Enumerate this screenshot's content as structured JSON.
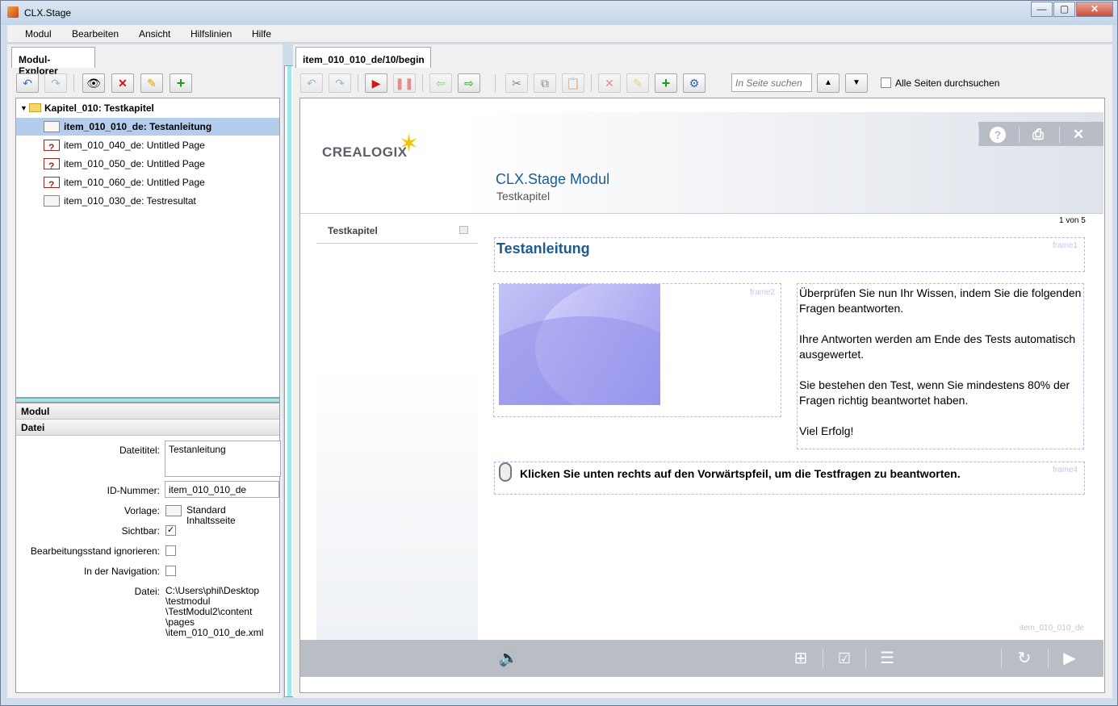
{
  "window": {
    "title": "CLX.Stage",
    "btn_minimize": "—",
    "btn_maximize": "▢",
    "btn_close": "✕"
  },
  "menu": [
    "Modul",
    "Bearbeiten",
    "Ansicht",
    "Hilfslinien",
    "Hilfe"
  ],
  "left_tab": "Modul-Explorer",
  "tree": {
    "folder": "Kapitel_010: Testkapitel",
    "items": [
      {
        "label": "item_010_010_de: Testanleitung",
        "selected": true
      },
      {
        "label": "item_010_040_de: Untitled Page"
      },
      {
        "label": "item_010_050_de: Untitled Page"
      },
      {
        "label": "item_010_060_de: Untitled Page"
      },
      {
        "label": "item_010_030_de: Testresultat"
      }
    ]
  },
  "props": {
    "section1": "Modul",
    "section2": "Datei",
    "dateititel_label": "Dateititel:",
    "dateititel": "Testanleitung",
    "id_label": "ID-Nummer:",
    "id": "item_010_010_de",
    "vorlage_label": "Vorlage:",
    "vorlage_line1": "Standard",
    "vorlage_line2": "Inhaltsseite",
    "sichtbar_label": "Sichtbar:",
    "bearb_label": "Bearbeitungsstand ignorieren:",
    "nav_label": "In der Navigation:",
    "datei_label": "Datei:",
    "datei_lines": [
      "C:\\Users\\phil\\Desktop",
      "\\testmodul",
      "\\TestModul2\\content",
      "\\pages",
      "\\item_010_010_de.xml"
    ]
  },
  "editor_tab": "item_010_010_de/10/begin",
  "search": {
    "placeholder": "In Seite suchen",
    "all_pages": "Alle Seiten durchsuchen"
  },
  "stage": {
    "logo": "CREALOGIX",
    "module_title": "CLX.Stage Modul",
    "chapter": "Testkapitel",
    "nav_item": "Testkapitel",
    "page_count": "1 von 5",
    "frame1": "frame1",
    "frame2": "frame2",
    "frame4": "frame4",
    "content_title": "Testanleitung",
    "paragraphs": [
      "Überprüfen Sie nun Ihr Wissen, indem Sie die folgenden Fragen beantworten.",
      "Ihre Antworten werden am Ende des Tests automatisch ausgewertet.",
      "Sie bestehen den Test, wenn Sie mindestens 80% der Fragen richtig beantwortet haben.",
      "Viel Erfolg!"
    ],
    "hint": "Klicken Sie unten rechts auf den Vorwärtspfeil, um die Testfragen zu beantworten.",
    "footer_id": "item_010_010_de"
  }
}
